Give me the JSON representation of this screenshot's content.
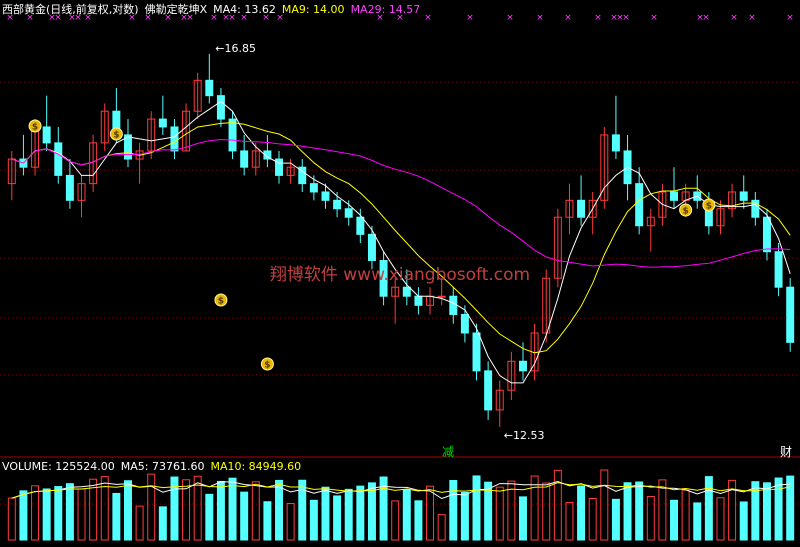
{
  "header": {
    "instrument": "西部黄金(日线,前复权,对数)",
    "indicator": "佛勒定乾坤X",
    "ma4_label": "MA4: 13.62",
    "ma9_label": "MA9: 14.00",
    "ma29_label": "MA29: 14.57"
  },
  "volume_header": {
    "volume_label": "VOLUME: 125524.00",
    "ma5_label": "MA5: 73761.60",
    "ma10_label": "MA10: 84949.60"
  },
  "annotations": {
    "high_label": "16.85",
    "low_label": "12.53",
    "jian_label": "减",
    "cai_label": "财",
    "watermark": "翔博软件 www.xiangbosoft.com",
    "bag_glyph": "$"
  },
  "colors": {
    "background": "#000000",
    "up": "#ff3c3c",
    "down": "#54ffff",
    "ma4": "#ffffff",
    "ma9": "#ffff00",
    "ma29": "#ff00ff",
    "grid": "#8b0000",
    "marker": "#ff40ff",
    "watermark": "#c04040"
  },
  "chart_data": {
    "type": "candlestick",
    "scale": "log",
    "price_min": 12.4,
    "price_max": 17.2,
    "candles": [
      [
        15.2,
        15.6,
        15.0,
        15.5
      ],
      [
        15.5,
        15.8,
        15.3,
        15.4
      ],
      [
        15.4,
        16.0,
        15.3,
        15.9
      ],
      [
        15.9,
        16.3,
        15.6,
        15.7
      ],
      [
        15.7,
        15.9,
        15.2,
        15.3
      ],
      [
        15.3,
        15.5,
        14.9,
        15.0
      ],
      [
        15.0,
        15.3,
        14.8,
        15.2
      ],
      [
        15.2,
        15.8,
        15.1,
        15.7
      ],
      [
        15.7,
        16.2,
        15.6,
        16.1
      ],
      [
        16.1,
        16.4,
        15.7,
        15.8
      ],
      [
        15.8,
        16.0,
        15.4,
        15.5
      ],
      [
        15.5,
        15.7,
        15.2,
        15.6
      ],
      [
        15.6,
        16.1,
        15.5,
        16.0
      ],
      [
        16.0,
        16.3,
        15.8,
        15.9
      ],
      [
        15.9,
        16.0,
        15.5,
        15.6
      ],
      [
        15.6,
        16.2,
        15.6,
        16.1
      ],
      [
        16.1,
        16.6,
        16.0,
        16.5
      ],
      [
        16.5,
        16.85,
        16.2,
        16.3
      ],
      [
        16.3,
        16.4,
        15.9,
        16.0
      ],
      [
        16.0,
        16.1,
        15.5,
        15.6
      ],
      [
        15.6,
        15.8,
        15.3,
        15.4
      ],
      [
        15.4,
        15.7,
        15.3,
        15.6
      ],
      [
        15.6,
        15.8,
        15.4,
        15.5
      ],
      [
        15.5,
        15.6,
        15.2,
        15.3
      ],
      [
        15.3,
        15.5,
        15.2,
        15.4
      ],
      [
        15.4,
        15.5,
        15.1,
        15.2
      ],
      [
        15.2,
        15.3,
        15.0,
        15.1
      ],
      [
        15.1,
        15.2,
        14.9,
        15.0
      ],
      [
        15.0,
        15.1,
        14.8,
        14.9
      ],
      [
        14.9,
        15.0,
        14.7,
        14.8
      ],
      [
        14.8,
        14.9,
        14.5,
        14.6
      ],
      [
        14.6,
        14.7,
        14.2,
        14.3
      ],
      [
        14.3,
        14.4,
        13.8,
        13.9
      ],
      [
        13.9,
        14.1,
        13.6,
        14.0
      ],
      [
        14.0,
        14.2,
        13.8,
        13.9
      ],
      [
        13.9,
        14.0,
        13.7,
        13.8
      ],
      [
        13.8,
        14.0,
        13.7,
        13.9
      ],
      [
        13.9,
        14.1,
        13.8,
        13.9
      ],
      [
        13.9,
        14.0,
        13.6,
        13.7
      ],
      [
        13.7,
        13.8,
        13.4,
        13.5
      ],
      [
        13.5,
        13.6,
        13.0,
        13.1
      ],
      [
        13.1,
        13.2,
        12.6,
        12.7
      ],
      [
        12.7,
        13.0,
        12.53,
        12.9
      ],
      [
        12.9,
        13.3,
        12.8,
        13.2
      ],
      [
        13.2,
        13.4,
        13.0,
        13.1
      ],
      [
        13.1,
        13.6,
        13.0,
        13.5
      ],
      [
        13.5,
        14.2,
        13.4,
        14.1
      ],
      [
        14.1,
        14.9,
        14.0,
        14.8
      ],
      [
        14.8,
        15.2,
        14.6,
        15.0
      ],
      [
        15.0,
        15.3,
        14.7,
        14.8
      ],
      [
        14.8,
        15.1,
        14.6,
        15.0
      ],
      [
        15.0,
        15.9,
        14.9,
        15.8
      ],
      [
        15.8,
        16.3,
        15.5,
        15.6
      ],
      [
        15.6,
        15.8,
        15.0,
        15.2
      ],
      [
        15.2,
        15.4,
        14.6,
        14.7
      ],
      [
        14.7,
        14.9,
        14.4,
        14.8
      ],
      [
        14.8,
        15.2,
        14.7,
        15.1
      ],
      [
        15.1,
        15.4,
        14.9,
        15.0
      ],
      [
        15.0,
        15.2,
        14.8,
        15.1
      ],
      [
        15.1,
        15.3,
        14.9,
        15.0
      ],
      [
        15.0,
        15.1,
        14.6,
        14.7
      ],
      [
        14.7,
        15.0,
        14.6,
        14.9
      ],
      [
        14.9,
        15.2,
        14.8,
        15.1
      ],
      [
        15.1,
        15.3,
        14.9,
        15.0
      ],
      [
        15.0,
        15.1,
        14.7,
        14.8
      ],
      [
        14.8,
        14.9,
        14.3,
        14.4
      ],
      [
        14.4,
        14.5,
        13.9,
        14.0
      ],
      [
        14.0,
        14.1,
        13.3,
        13.4
      ]
    ]
  }
}
